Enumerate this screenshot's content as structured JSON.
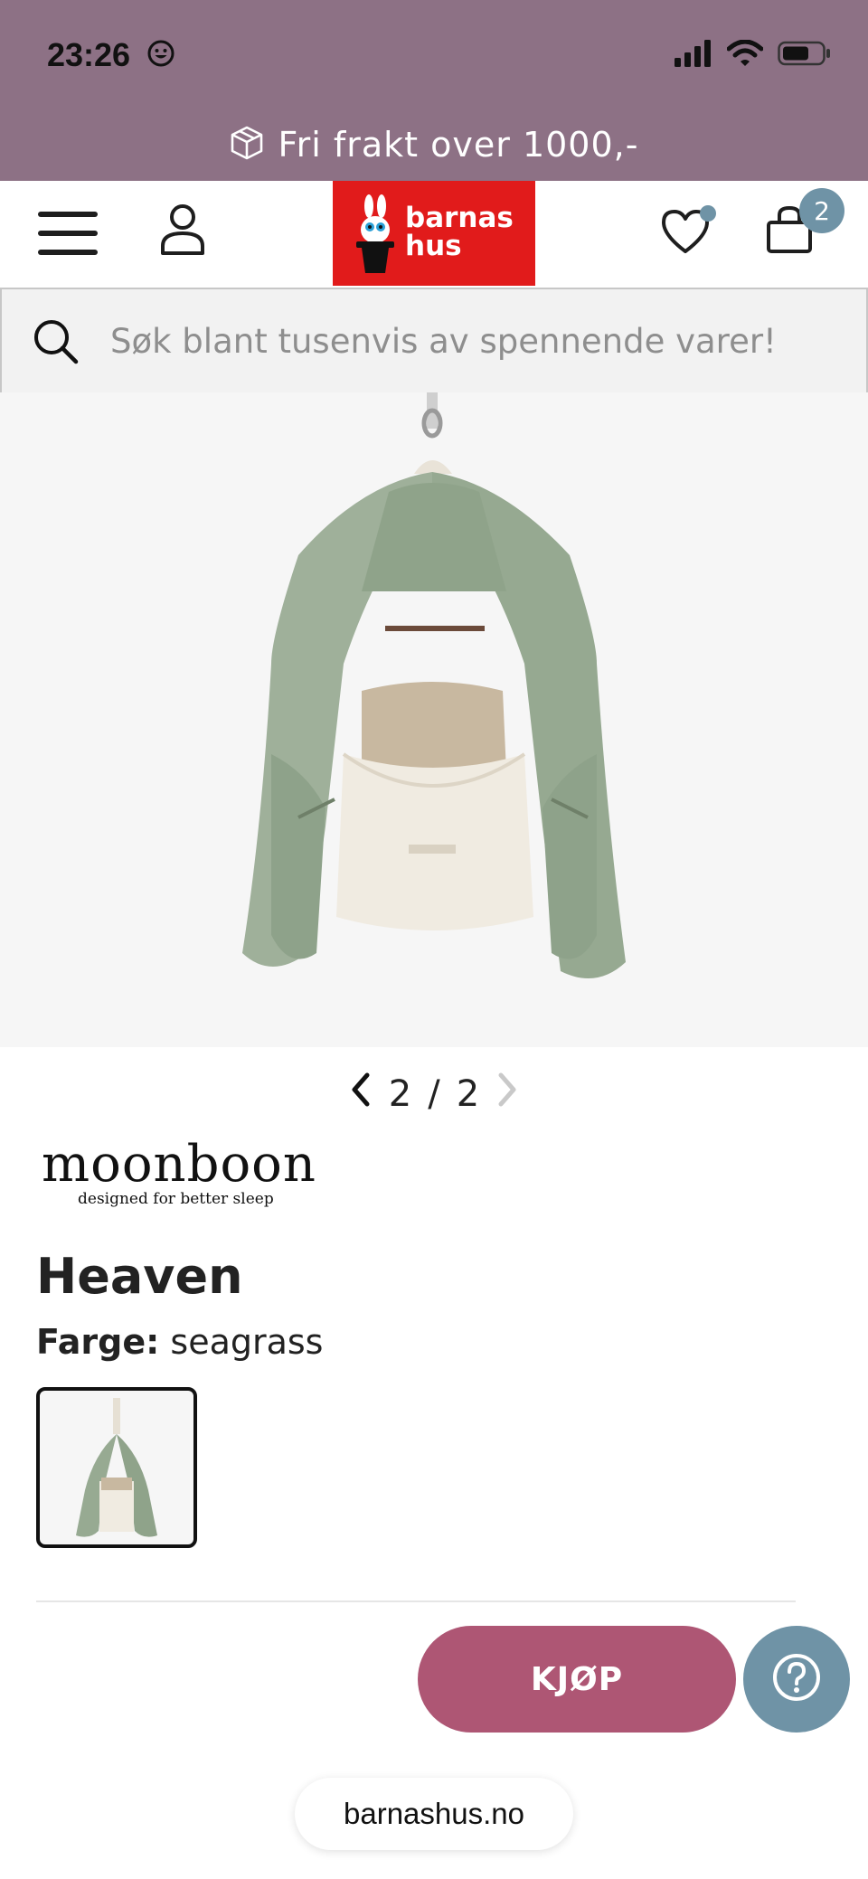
{
  "status": {
    "time": "23:26",
    "emoji_icon": "smiley-icon",
    "icons": [
      "cellular-signal-icon",
      "wifi-icon",
      "battery-icon"
    ]
  },
  "promo": {
    "icon": "package-icon",
    "text": "Fri frakt over 1000,-"
  },
  "header": {
    "logo_line1": "barnas",
    "logo_line2": "hus",
    "cart_count": "2",
    "colors": {
      "logo_bg": "#e11b1b",
      "badge": "#6f93a6"
    }
  },
  "search": {
    "placeholder": "Søk blant tusenvis av spennende varer!"
  },
  "gallery": {
    "current": "2",
    "separator": "/",
    "total": "2"
  },
  "product": {
    "brand_name": "moonboon",
    "brand_tagline": "designed for better sleep",
    "title": "Heaven",
    "color_label": "Farge:",
    "color_value": "seagrass"
  },
  "actions": {
    "buy_label": "KJØP",
    "buy_color": "#ae5674",
    "help_color": "#6f93a6"
  },
  "browser": {
    "url": "barnashus.no"
  }
}
